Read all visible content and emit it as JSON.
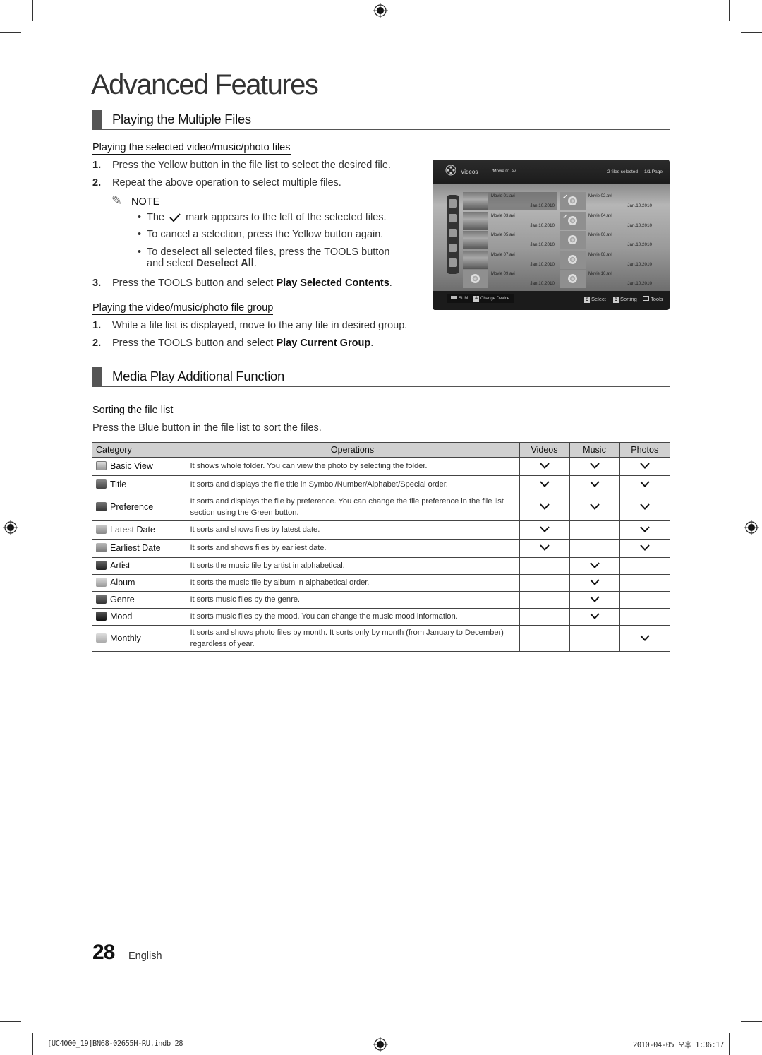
{
  "page": {
    "title": "Advanced Features",
    "page_number": "28",
    "language": "English"
  },
  "section1": {
    "title": "Playing the Multiple Files",
    "sub1": {
      "title": "Playing the selected video/music/photo files",
      "steps": [
        {
          "num": "1.",
          "text": "Press the Yellow button in the file list to select the desired file."
        },
        {
          "num": "2.",
          "text": "Repeat the above operation to select multiple files."
        }
      ],
      "note_label": "NOTE",
      "bullets": [
        {
          "pre": "The",
          "post": "mark appears to the left of the selected files."
        },
        {
          "text": "To cancel a selection, press the Yellow button again."
        },
        {
          "pre": "To deselect all selected files, press the",
          "key": "TOOLS",
          "post": "button",
          "line2_pre": "and select",
          "line2_bold": "Deselect All",
          "line2_post": "."
        }
      ],
      "step3": {
        "num": "3.",
        "pre": "Press the",
        "key": "TOOLS",
        "mid": "button and select",
        "bold": "Play Selected Contents",
        "post": "."
      }
    },
    "sub2": {
      "title": "Playing the video/music/photo file group",
      "step1": {
        "num": "1.",
        "text": "While a file list is displayed, move to the any file in desired group."
      },
      "step2": {
        "num": "2.",
        "pre": "Press the",
        "key": "TOOLS",
        "mid": "button and select",
        "bold": "Play Current Group",
        "post": "."
      }
    }
  },
  "tv_screen": {
    "category": "Videos",
    "path": "/Movie 01.avi",
    "selection_status": "2 files selected",
    "page_indicator": "1/1 Page",
    "files": [
      {
        "name": "Movie 01.avi",
        "date": "Jan.10.2010",
        "focused": true,
        "selected": false,
        "thumb": "photo"
      },
      {
        "name": "Movie 02.avi",
        "date": "Jan.10.2010",
        "focused": false,
        "selected": true,
        "thumb": "reel"
      },
      {
        "name": "Movie 03.avi",
        "date": "Jan.10.2010",
        "focused": false,
        "selected": false,
        "thumb": "photo"
      },
      {
        "name": "Movie 04.avi",
        "date": "Jan.10.2010",
        "focused": false,
        "selected": true,
        "thumb": "reel"
      },
      {
        "name": "Movie 05.avi",
        "date": "Jan.10.2010",
        "focused": false,
        "selected": false,
        "thumb": "photo"
      },
      {
        "name": "Movie 06.avi",
        "date": "Jan.10.2010",
        "focused": false,
        "selected": false,
        "thumb": "reel"
      },
      {
        "name": "Movie 07.avi",
        "date": "Jan.10.2010",
        "focused": false,
        "selected": false,
        "thumb": "photo"
      },
      {
        "name": "Movie 08.avi",
        "date": "Jan.10.2010",
        "focused": false,
        "selected": false,
        "thumb": "reel"
      },
      {
        "name": "Movie 09.avi",
        "date": "Jan.10.2010",
        "focused": false,
        "selected": false,
        "thumb": "reel"
      },
      {
        "name": "Movie 10.avi",
        "date": "Jan.10.2010",
        "focused": false,
        "selected": false,
        "thumb": "reel"
      }
    ],
    "bottom": {
      "sum_label": "SUM",
      "a_key": "A",
      "change_device": "Change Device",
      "c_key": "C",
      "select": "Select",
      "d_key": "D",
      "sorting": "Sorting",
      "tools": "Tools"
    }
  },
  "section2": {
    "title": "Media Play Additional Function",
    "sub_title": "Sorting the file list",
    "intro": "Press the Blue button in the file list to sort the files.",
    "table": {
      "headers": [
        "Category",
        "Operations",
        "Videos",
        "Music",
        "Photos"
      ],
      "rows": [
        {
          "icon": "folder-icon",
          "category": "Basic View",
          "operation": "It shows whole folder. You can view the photo by selecting the folder.",
          "videos": true,
          "music": true,
          "photos": true
        },
        {
          "icon": "az-icon",
          "category": "Title",
          "operation": "It sorts and displays the file title in Symbol/Number/Alphabet/Special order.",
          "videos": true,
          "music": true,
          "photos": true
        },
        {
          "icon": "star-icon",
          "category": "Preference",
          "operation": "It sorts and displays the file by preference. You can change the file preference in the file list section using the Green button.",
          "videos": true,
          "music": true,
          "photos": true
        },
        {
          "icon": "calendar-30-icon",
          "category": "Latest Date",
          "operation": "It sorts and shows files by latest date.",
          "videos": true,
          "music": false,
          "photos": true
        },
        {
          "icon": "calendar-1-icon",
          "category": "Earliest Date",
          "operation": "It sorts and shows files by earliest date.",
          "videos": true,
          "music": false,
          "photos": true
        },
        {
          "icon": "artist-icon",
          "category": "Artist",
          "operation": "It sorts the music file by artist in alphabetical.",
          "videos": false,
          "music": true,
          "photos": false
        },
        {
          "icon": "album-icon",
          "category": "Album",
          "operation": "It sorts the music file by album in alphabetical order.",
          "videos": false,
          "music": true,
          "photos": false
        },
        {
          "icon": "genre-icon",
          "category": "Genre",
          "operation": "It sorts music files by the genre.",
          "videos": false,
          "music": true,
          "photos": false
        },
        {
          "icon": "mood-icon",
          "category": "Mood",
          "operation": "It sorts music files by the mood. You can change the music mood information.",
          "videos": false,
          "music": true,
          "photos": false
        },
        {
          "icon": "calendar-month-icon",
          "category": "Monthly",
          "operation": "It sorts and shows photo files by month. It sorts only by month (from January to December) regardless of year.",
          "videos": false,
          "music": false,
          "photos": true
        }
      ]
    }
  },
  "print_slug": {
    "file": "[UC4000_19]BN68-02655H-RU.indb   28",
    "timestamp": "2010-04-05   오후 1:36:17"
  }
}
